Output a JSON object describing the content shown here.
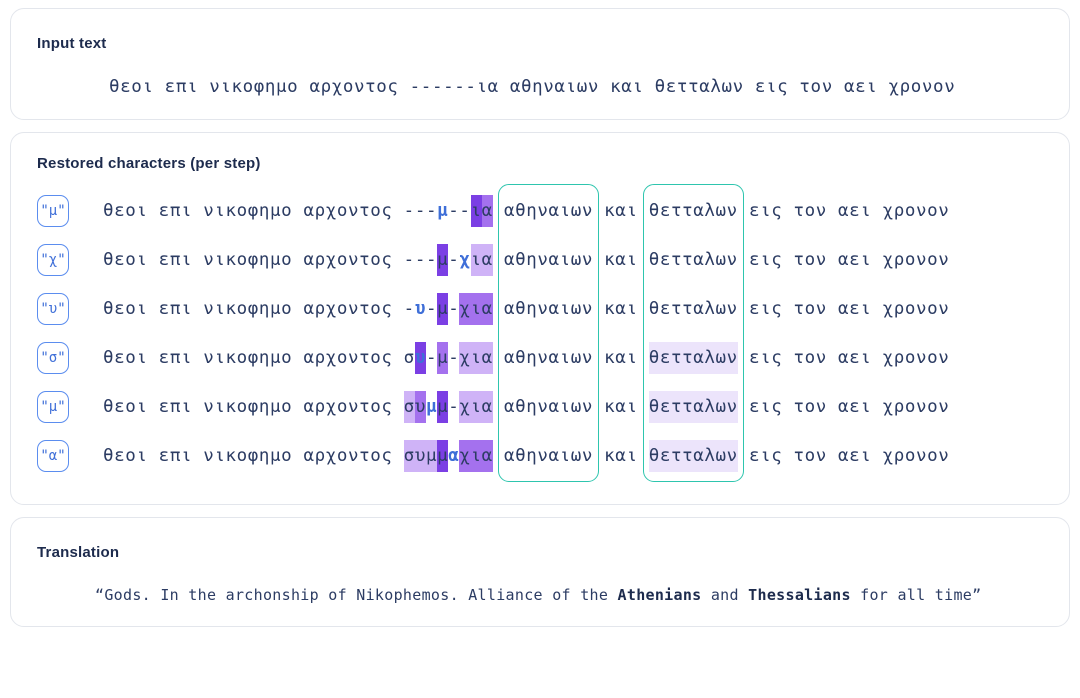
{
  "input_panel": {
    "title": "Input text",
    "text": "θεοι επι νικοφημο αρχοντος ------ια αθηναιων και θετταλων εις τον αει χρονον"
  },
  "steps_panel": {
    "title": "Restored characters (per step)",
    "colors": {
      "text": "#2c3c63",
      "predicted_char": "#3f6fd8",
      "badge_border": "#5b8def",
      "highlight_box": "#2ec5ae",
      "fill_dark": "#7b3fe4",
      "fill_mid": "#a471ee",
      "fill_light": "#cfb3f7",
      "fill_faint": "#ece4fb"
    },
    "column_boxes": [
      {
        "label": "αθηναιων"
      },
      {
        "label": "θετταλων"
      }
    ],
    "steps": [
      {
        "badge": "\"μ\"",
        "prefix": "θεοι επι νικοφημο αρχοντος ",
        "gap": [
          {
            "c": "-",
            "fill": "none",
            "pred": false
          },
          {
            "c": "-",
            "fill": "none",
            "pred": false
          },
          {
            "c": "-",
            "fill": "none",
            "pred": false
          },
          {
            "c": "μ",
            "fill": "none",
            "pred": true
          },
          {
            "c": "-",
            "fill": "none",
            "pred": false
          },
          {
            "c": "-",
            "fill": "none",
            "pred": false
          },
          {
            "c": "ι",
            "fill": "dark",
            "pred": false
          },
          {
            "c": "α",
            "fill": "mid",
            "pred": false
          }
        ],
        "word1": "αθηναιων",
        "word1_fill": "none",
        "mid": " και ",
        "word2": "θετταλων",
        "word2_fill": "none",
        "suffix": " εις τον αει χρονον"
      },
      {
        "badge": "\"χ\"",
        "prefix": "θεοι επι νικοφημο αρχοντος ",
        "gap": [
          {
            "c": "-",
            "fill": "none",
            "pred": false
          },
          {
            "c": "-",
            "fill": "none",
            "pred": false
          },
          {
            "c": "-",
            "fill": "none",
            "pred": false
          },
          {
            "c": "μ",
            "fill": "dark",
            "pred": false
          },
          {
            "c": "-",
            "fill": "none",
            "pred": false
          },
          {
            "c": "χ",
            "fill": "none",
            "pred": true
          },
          {
            "c": "ι",
            "fill": "light",
            "pred": false
          },
          {
            "c": "α",
            "fill": "light",
            "pred": false
          }
        ],
        "word1": "αθηναιων",
        "word1_fill": "none",
        "mid": " και ",
        "word2": "θετταλων",
        "word2_fill": "none",
        "suffix": " εις τον αει χρονον"
      },
      {
        "badge": "\"υ\"",
        "prefix": "θεοι επι νικοφημο αρχοντος ",
        "gap": [
          {
            "c": "-",
            "fill": "none",
            "pred": false
          },
          {
            "c": "υ",
            "fill": "none",
            "pred": true
          },
          {
            "c": "-",
            "fill": "none",
            "pred": false
          },
          {
            "c": "μ",
            "fill": "dark",
            "pred": false
          },
          {
            "c": "-",
            "fill": "none",
            "pred": false
          },
          {
            "c": "χ",
            "fill": "mid",
            "pred": false
          },
          {
            "c": "ι",
            "fill": "mid",
            "pred": false
          },
          {
            "c": "α",
            "fill": "mid",
            "pred": false
          }
        ],
        "word1": "αθηναιων",
        "word1_fill": "none",
        "mid": " και ",
        "word2": "θετταλων",
        "word2_fill": "none",
        "suffix": " εις τον αει χρονον"
      },
      {
        "badge": "\"σ\"",
        "prefix": "θεοι επι νικοφημο αρχοντος ",
        "gap": [
          {
            "c": "σ",
            "fill": "none",
            "pred": false
          },
          {
            "c": "υ",
            "fill": "dark",
            "pred": true
          },
          {
            "c": "-",
            "fill": "none",
            "pred": false
          },
          {
            "c": "μ",
            "fill": "mid",
            "pred": false
          },
          {
            "c": "-",
            "fill": "none",
            "pred": false
          },
          {
            "c": "χ",
            "fill": "light",
            "pred": false
          },
          {
            "c": "ι",
            "fill": "light",
            "pred": false
          },
          {
            "c": "α",
            "fill": "light",
            "pred": false
          }
        ],
        "word1": "αθηναιων",
        "word1_fill": "none",
        "mid": " και ",
        "word2": "θετταλων",
        "word2_fill": "faint",
        "suffix": " εις τον αει χρονον"
      },
      {
        "badge": "\"μ\"",
        "prefix": "θεοι επι νικοφημο αρχοντος ",
        "gap": [
          {
            "c": "σ",
            "fill": "light",
            "pred": false
          },
          {
            "c": "υ",
            "fill": "mid",
            "pred": false
          },
          {
            "c": "μ",
            "fill": "none",
            "pred": true
          },
          {
            "c": "μ",
            "fill": "dark",
            "pred": false
          },
          {
            "c": "-",
            "fill": "none",
            "pred": false
          },
          {
            "c": "χ",
            "fill": "light",
            "pred": false
          },
          {
            "c": "ι",
            "fill": "light",
            "pred": false
          },
          {
            "c": "α",
            "fill": "light",
            "pred": false
          }
        ],
        "word1": "αθηναιων",
        "word1_fill": "none",
        "mid": " και ",
        "word2": "θετταλων",
        "word2_fill": "faint",
        "suffix": " εις τον αει χρονον"
      },
      {
        "badge": "\"α\"",
        "prefix": "θεοι επι νικοφημο αρχοντος ",
        "gap": [
          {
            "c": "σ",
            "fill": "light",
            "pred": false
          },
          {
            "c": "υ",
            "fill": "light",
            "pred": false
          },
          {
            "c": "μ",
            "fill": "light",
            "pred": false
          },
          {
            "c": "μ",
            "fill": "dark",
            "pred": false
          },
          {
            "c": "α",
            "fill": "none",
            "pred": true
          },
          {
            "c": "χ",
            "fill": "mid",
            "pred": false
          },
          {
            "c": "ι",
            "fill": "mid",
            "pred": false
          },
          {
            "c": "α",
            "fill": "mid",
            "pred": false
          }
        ],
        "word1": "αθηναιων",
        "word1_fill": "none",
        "mid": " και ",
        "word2": "θετταλων",
        "word2_fill": "faint",
        "suffix": " εις τον αει χρονον"
      }
    ]
  },
  "translation_panel": {
    "title": "Translation",
    "parts": [
      {
        "t": "“Gods. In the archonship of Nikophemos. Alliance of the ",
        "bold": false
      },
      {
        "t": "Athenians",
        "bold": true
      },
      {
        "t": " and ",
        "bold": false
      },
      {
        "t": "Thessalians",
        "bold": true
      },
      {
        "t": " for all time”",
        "bold": false
      }
    ]
  }
}
